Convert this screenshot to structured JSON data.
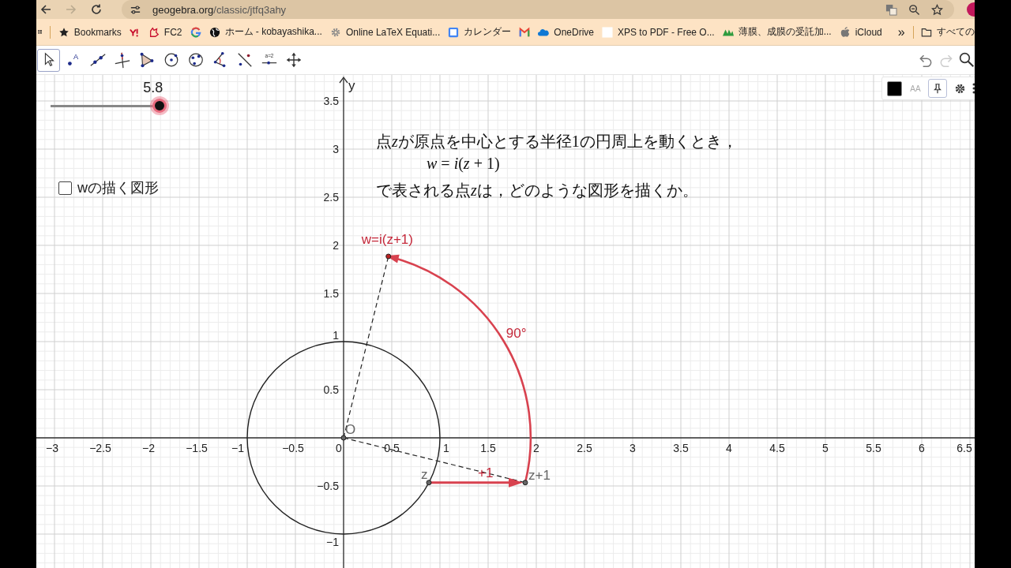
{
  "browser": {
    "url_host": "geogebra.org",
    "url_path": "/classic/jtfq3ahy",
    "forward_disabled": true,
    "bookmarks": [
      {
        "kind": "star",
        "label": "Bookmarks"
      },
      {
        "kind": "yahoo"
      },
      {
        "kind": "fc2",
        "label": "FC2"
      },
      {
        "kind": "google"
      },
      {
        "kind": "globe",
        "label": "ホーム - kobayashika..."
      },
      {
        "kind": "gear",
        "label": "Online LaTeX Equati..."
      },
      {
        "kind": "calendar",
        "label": "カレンダー"
      },
      {
        "kind": "mail"
      },
      {
        "kind": "cloud",
        "label": "OneDrive"
      },
      {
        "kind": "page",
        "label": "XPS to PDF - Free O..."
      },
      {
        "kind": "mountain",
        "label": "薄膜、成膜の受託加..."
      },
      {
        "kind": "apple",
        "label": "iCloud"
      }
    ],
    "overflow": "»",
    "folder": "すべての"
  },
  "toolbar": {
    "tools": [
      {
        "kind": "move",
        "selected": true
      },
      {
        "kind": "point",
        "label": "A",
        "selected": false
      },
      {
        "kind": "line",
        "selected": false
      },
      {
        "kind": "perpendicular",
        "selected": false
      },
      {
        "kind": "polygon",
        "selected": false
      },
      {
        "kind": "circle_center",
        "selected": false
      },
      {
        "kind": "circle_3",
        "selected": false
      },
      {
        "kind": "angle",
        "selected": false
      },
      {
        "kind": "reflect",
        "selected": false
      },
      {
        "kind": "slider",
        "label": "a=2",
        "selected": false
      },
      {
        "kind": "move_view",
        "selected": false
      }
    ],
    "undo": {
      "disabled": false
    },
    "redo": {
      "disabled": true
    }
  },
  "style_bar": {
    "font_button": "AA"
  },
  "slider": {
    "value": "5.8",
    "level": 0.923
  },
  "checkbox": {
    "label": "wの描く図形",
    "checked": false
  },
  "problem": [
    {
      "kind": "text",
      "segments": [
        {
          "text": "点"
        },
        {
          "text": "z",
          "italic": true
        },
        {
          "text": "が原点を中心とする半径1の円周上を動くとき，"
        }
      ]
    },
    {
      "kind": "formula",
      "segments": [
        {
          "text": "w",
          "italic": true
        },
        {
          "text": " = "
        },
        {
          "text": "i",
          "italic": true
        },
        {
          "text": "("
        },
        {
          "text": "z",
          "italic": true
        },
        {
          "text": " + 1)"
        }
      ]
    },
    {
      "kind": "text",
      "segments": [
        {
          "text": "で表される点"
        },
        {
          "text": "z",
          "italic": true
        },
        {
          "text": "は，どのような図形を描くか。"
        }
      ]
    }
  ],
  "graph": {
    "y_label": "y",
    "x_ticks": [
      "−3",
      "−2.5",
      "−2",
      "−1.5",
      "−1",
      "−0.5",
      "0",
      "0.5",
      "1",
      "1.5",
      "2",
      "2.5",
      "3",
      "3.5",
      "4",
      "4.5",
      "5",
      "5.5",
      "6",
      "6.5"
    ],
    "y_ticks": [
      "3.5",
      "3",
      "2.5",
      "2",
      "1.5",
      "1",
      "0.5",
      "−0.5",
      "−1"
    ],
    "labels": {
      "origin": "O",
      "z": "z",
      "z_plus_1": "z+1",
      "w": "w=i(z+1)",
      "shift": "+1",
      "angle": "90°"
    }
  }
}
